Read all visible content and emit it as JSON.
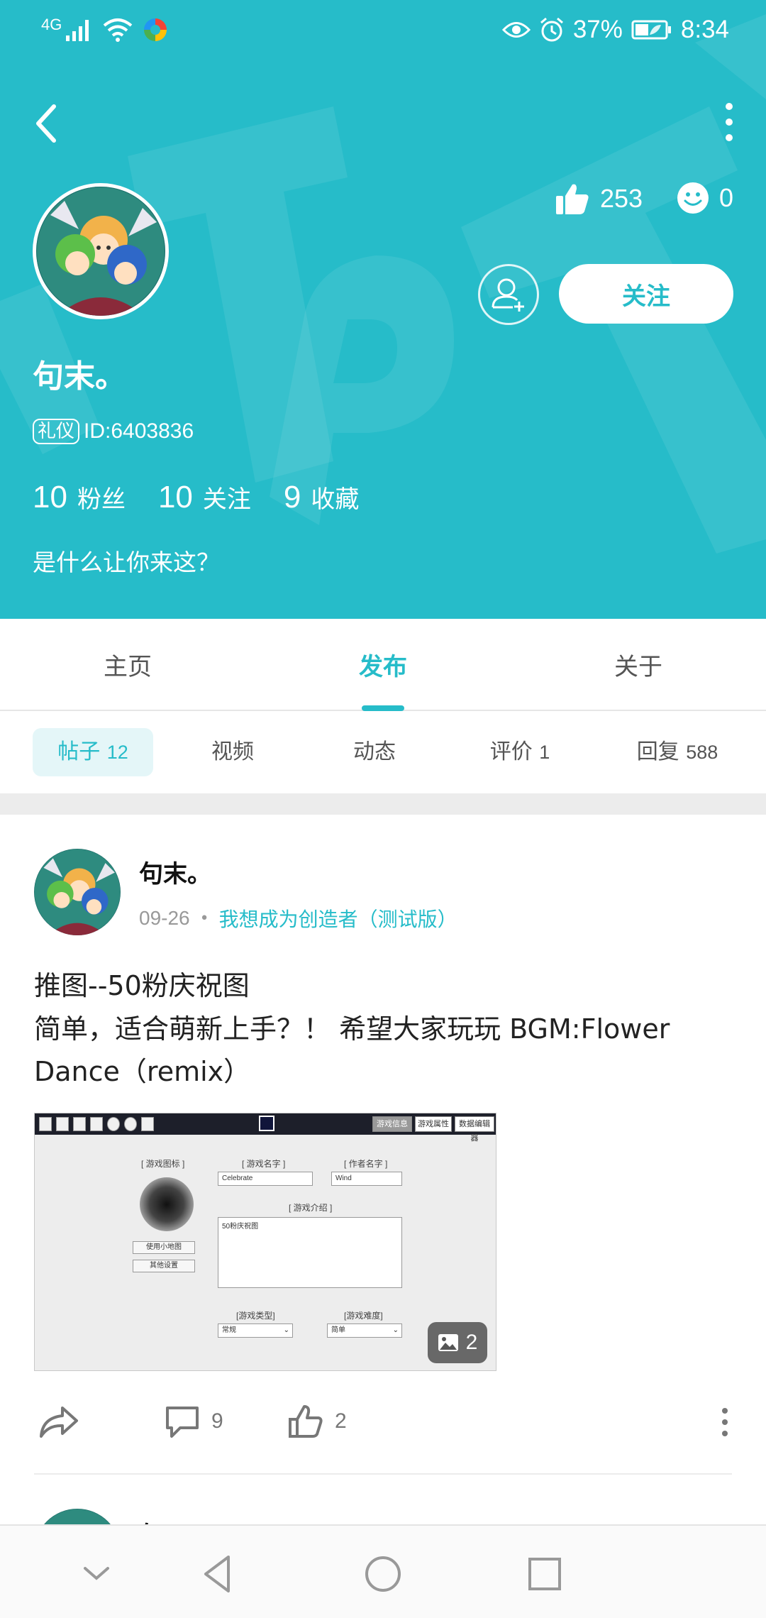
{
  "status_bar": {
    "signal": "4G",
    "battery": "37%",
    "time": "8:34"
  },
  "profile": {
    "username": "句末。",
    "badge": "礼仪",
    "user_id": "ID:6403836",
    "likes": "253",
    "emotes": "0",
    "follow_label": "关注",
    "stats": [
      {
        "num": "10",
        "label": "粉丝"
      },
      {
        "num": "10",
        "label": "关注"
      },
      {
        "num": "9",
        "label": "收藏"
      }
    ],
    "bio": "是什么让你来这？"
  },
  "main_tabs": [
    "主页",
    "发布",
    "关于"
  ],
  "main_tab_active": "发布",
  "sub_tabs": [
    {
      "label": "帖子",
      "count": "12"
    },
    {
      "label": "视频",
      "count": ""
    },
    {
      "label": "动态",
      "count": ""
    },
    {
      "label": "评价",
      "count": "1"
    },
    {
      "label": "回复",
      "count": "588"
    }
  ],
  "post": {
    "author": "句末。",
    "date": "09-26",
    "forum": "我想成为创造者（测试版）",
    "title": "推图--50粉庆祝图",
    "body": "简单，适合萌新上手？！  希望大家玩玩 BGM:Flower Dance（remix）",
    "image_count": "2",
    "comments": "9",
    "likes": "2",
    "image": {
      "tabs": [
        "游戏信息",
        "游戏属性",
        "数据编辑器"
      ],
      "icon_label": "[ 游戏图标 ]",
      "name_label": "[ 游戏名字 ]",
      "name_value": "Celebrate",
      "author_label": "[ 作者名字 ]",
      "author_value": "Wind",
      "intro_label": "[ 游戏介绍 ]",
      "intro_value": "50粉庆祝图",
      "use_thumb_btn": "使用小地图",
      "other_settings_btn": "其他设置",
      "type_label": "[游戏类型]",
      "type_value": "常规",
      "difficulty_label": "[游戏难度]",
      "difficulty_value": "简单"
    }
  },
  "next_post": {
    "author": "句末。"
  },
  "colors": {
    "accent": "#26bcc9",
    "header_bg": "#26bcc9"
  }
}
